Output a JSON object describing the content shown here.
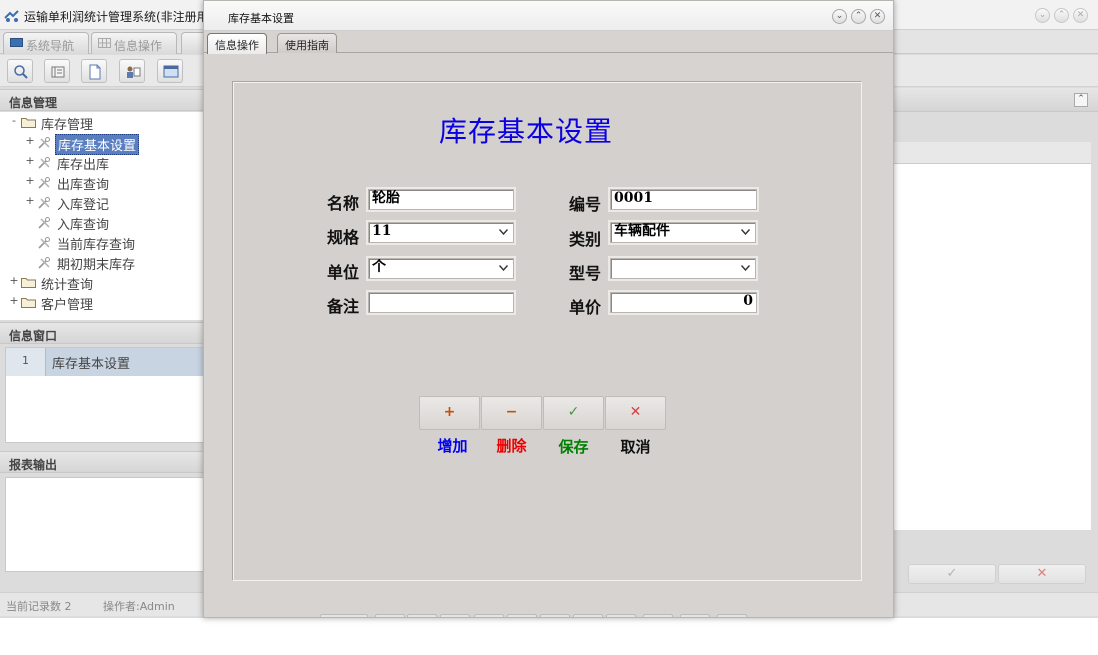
{
  "app": {
    "title": "运输单利润统计管理系统(非注册用户",
    "tabs": [
      {
        "label": "系统导航"
      },
      {
        "label": "信息操作"
      }
    ]
  },
  "left_panel": {
    "info_mgmt_title": "信息管理",
    "tree": [
      {
        "label": "库存管理",
        "toggle": "-"
      },
      {
        "label": "库存基本设置",
        "toggle": "+"
      },
      {
        "label": "库存出库",
        "toggle": "+"
      },
      {
        "label": "出库查询",
        "toggle": "+"
      },
      {
        "label": "入库登记",
        "toggle": "+"
      },
      {
        "label": "入库查询"
      },
      {
        "label": "当前库存查询"
      },
      {
        "label": "期初期末库存"
      },
      {
        "label": "统计查询",
        "toggle": "+"
      },
      {
        "label": "客户管理",
        "toggle": "+"
      }
    ],
    "info_window_title": "信息窗口",
    "info_window_rows": [
      {
        "num": "1",
        "label": "库存基本设置"
      }
    ],
    "report_title": "报表输出"
  },
  "status_bar": {
    "record_count": "当前记录数 2",
    "operator": "操作者:Admin"
  },
  "right_panel": {
    "buttons": [
      {
        "glyph": "✓",
        "color": "#b4b4b4"
      },
      {
        "glyph": "✕",
        "color": "#e08080"
      }
    ]
  },
  "dialog": {
    "title": "库存基本设置",
    "tabs": [
      {
        "label": "信息操作"
      },
      {
        "label": "使用指南"
      }
    ],
    "form": {
      "heading": "库存基本设置",
      "name": {
        "label": "名称",
        "value": "轮胎"
      },
      "code": {
        "label": "编号",
        "value": "0001"
      },
      "spec": {
        "label": "规格",
        "value": "11"
      },
      "category": {
        "label": "类别",
        "value": "车辆配件"
      },
      "unit": {
        "label": "单位",
        "value": "个"
      },
      "model": {
        "label": "型号",
        "value": ""
      },
      "note": {
        "label": "备注",
        "value": ""
      },
      "price": {
        "label": "单价",
        "value": "0"
      }
    },
    "actions": [
      {
        "label": "增加",
        "glyph": "+",
        "glyph_color": "#d24a00",
        "label_color": "#0000ee"
      },
      {
        "label": "删除",
        "glyph": "−",
        "glyph_color": "#d24a00",
        "label_color": "#ee0000"
      },
      {
        "label": "保存",
        "glyph": "✓",
        "glyph_color": "#3f9a3f",
        "label_color": "#008000"
      },
      {
        "label": "取消",
        "glyph": "✕",
        "glyph_color": "#d84040",
        "label_color": "#111111"
      }
    ]
  }
}
